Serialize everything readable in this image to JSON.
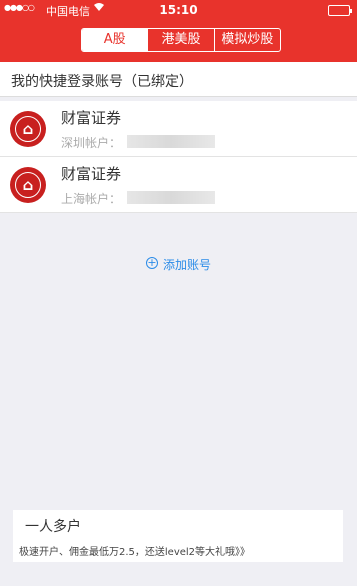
{
  "status_bar": {
    "signal": "●●●○○",
    "carrier": "中国电信",
    "time": "15:10"
  },
  "tabs": [
    {
      "label": "A股",
      "active": true
    },
    {
      "label": "港美股",
      "active": false
    },
    {
      "label": "模拟炒股",
      "active": false
    }
  ],
  "section_title": "我的快捷登录账号（已绑定）",
  "accounts": [
    {
      "broker": "财富证券",
      "market_label": "深圳帐户："
    },
    {
      "broker": "财富证券",
      "market_label": "上海帐户："
    }
  ],
  "add_account": {
    "label": "添加账号",
    "icon": "plus-circle-icon"
  },
  "promo": {
    "title": "一人多户",
    "description": "极速开户、佣金最低万2.5，还送level2等大礼哦》》"
  },
  "colors": {
    "brand_red": "#e8332c",
    "link_blue": "#2b8ce8",
    "background": "#efeff4"
  }
}
